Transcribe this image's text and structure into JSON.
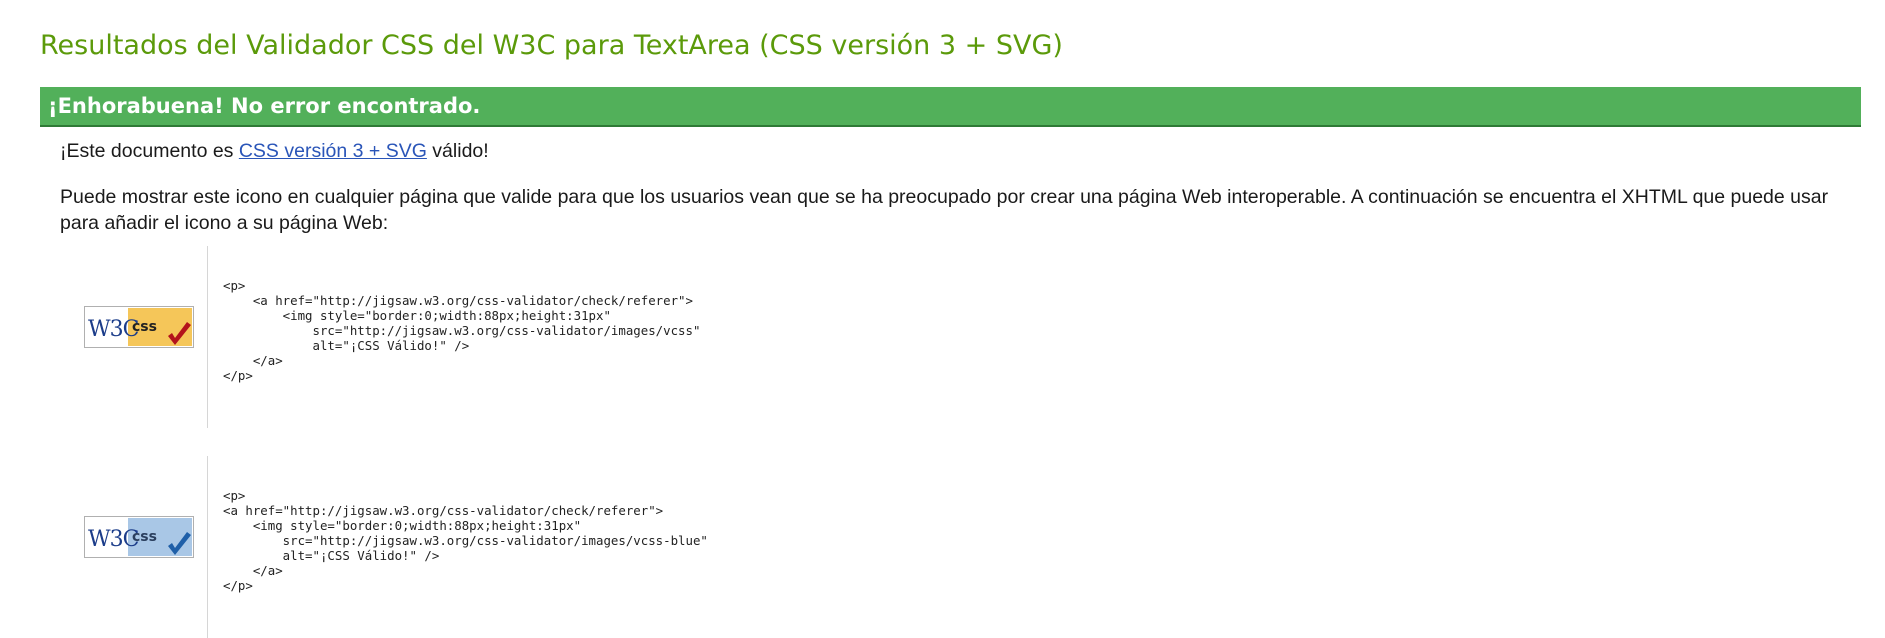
{
  "title": "Resultados del Validador CSS del W3C para TextArea (CSS versión 3 + SVG)",
  "banner": "¡Enhorabuena! No error encontrado.",
  "valid_line": {
    "prefix": "¡Este documento es ",
    "link": "CSS versión 3 + SVG",
    "suffix": " válido!"
  },
  "info": "Puede mostrar este icono en cualquier página que valide para que los usuarios vean que se ha preocupado por crear una página Web interoperable. A continuación se encuentra el XHTML que puede usar para añadir el icono a su página Web:",
  "badges": [
    {
      "w3c": "W3C",
      "css": "css",
      "code": "<p>\n    <a href=\"http://jigsaw.w3.org/css-validator/check/referer\">\n        <img style=\"border:0;width:88px;height:31px\"\n            src=\"http://jigsaw.w3.org/css-validator/images/vcss\"\n            alt=\"¡CSS Válido!\" />\n    </a>\n</p>"
    },
    {
      "w3c": "W3C",
      "css": "css",
      "code": "<p>\n<a href=\"http://jigsaw.w3.org/css-validator/check/referer\">\n    <img style=\"border:0;width:88px;height:31px\"\n        src=\"http://jigsaw.w3.org/css-validator/images/vcss-blue\"\n        alt=\"¡CSS Válido!\" />\n    </a>\n</p>"
    }
  ],
  "colors": {
    "title": "#5b9a0a",
    "banner_bg": "#52b05a",
    "link": "#2a55b8",
    "badge_gold": "#f5c659",
    "badge_blue": "#a9c7e6",
    "check_red": "#b3131b",
    "check_blue": "#1f5fa8"
  }
}
